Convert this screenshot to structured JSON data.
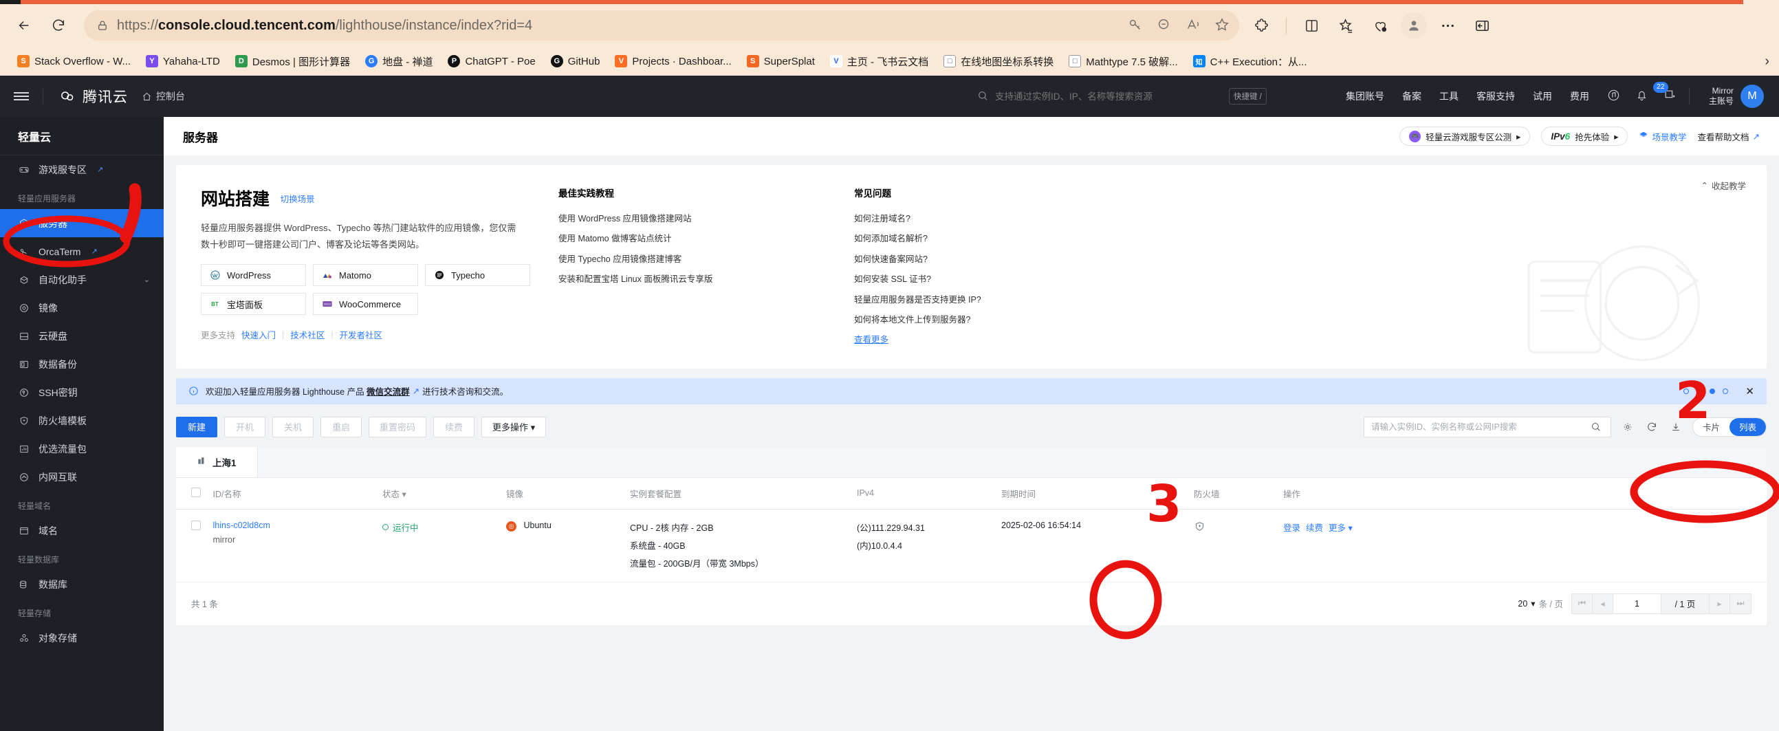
{
  "browser": {
    "url_prefix": "https://",
    "url_domain": "console.cloud.tencent.com",
    "url_path": "/lighthouse/instance/index?rid=4",
    "bookmarks": [
      {
        "label": "Stack Overflow - W...",
        "icon": "stackoverflow-icon",
        "color": "#f48024",
        "glyph": "S"
      },
      {
        "label": "Yahaha-LTD",
        "icon": "yahaha-icon",
        "color": "#7b4cf0",
        "glyph": "Y"
      },
      {
        "label": "Desmos | 图形计算器",
        "icon": "desmos-icon",
        "color": "#2d9a4f",
        "glyph": "D"
      },
      {
        "label": "地盘 - 禅道",
        "icon": "zentao-icon",
        "color": "#2b7cff",
        "glyph": "G"
      },
      {
        "label": "ChatGPT - Poe",
        "icon": "poe-icon",
        "color": "#111111",
        "glyph": "P"
      },
      {
        "label": "GitHub",
        "icon": "github-icon",
        "color": "#111111",
        "glyph": "G"
      },
      {
        "label": "Projects · Dashboar...",
        "icon": "gitlab-icon",
        "color": "#fc6d26",
        "glyph": "V"
      },
      {
        "label": "SuperSplat",
        "icon": "supersplat-icon",
        "color": "#f26722",
        "glyph": "S"
      },
      {
        "label": "主页 - 飞书云文档",
        "icon": "feishu-icon",
        "color": "#2b5fff",
        "glyph": "V"
      },
      {
        "label": "在线地图坐标系转换",
        "icon": "page-icon",
        "color": "#ffffff",
        "glyph": "□"
      },
      {
        "label": "Mathtype 7.5 破解...",
        "icon": "page-icon",
        "color": "#ffffff",
        "glyph": "□"
      },
      {
        "label": "C++ Execution：从...",
        "icon": "zhihu-icon",
        "color": "#0084ff",
        "glyph": "知"
      }
    ],
    "overflow_label": "›"
  },
  "topnav": {
    "brand": "腾讯云",
    "console_label": "控制台",
    "search_placeholder": "支持通过实例ID、IP、名称等搜索资源",
    "shortcut_key": "快捷键 /",
    "menu": [
      "集团账号",
      "备案",
      "工具",
      "客服支持",
      "试用",
      "费用"
    ],
    "notification_count": "22",
    "user_name_line1": "Mirror",
    "user_name_line2": "主账号",
    "user_initial": "M"
  },
  "sidebar": {
    "title": "轻量云",
    "items": [
      {
        "label": "游戏服专区",
        "icon": "gamepad-icon",
        "external": true,
        "active": false
      },
      {
        "group": "轻量应用服务器"
      },
      {
        "label": "服务器",
        "icon": "server-cube-icon",
        "external": false,
        "active": true
      },
      {
        "label": "OrcaTerm",
        "icon": "orcaterm-icon",
        "external": true,
        "active": false
      },
      {
        "label": "自动化助手",
        "icon": "robot-icon",
        "external": false,
        "active": false,
        "expandable": true
      },
      {
        "label": "镜像",
        "icon": "disc-icon",
        "external": false,
        "active": false
      },
      {
        "label": "云硬盘",
        "icon": "harddisk-icon",
        "external": false,
        "active": false
      },
      {
        "label": "数据备份",
        "icon": "backup-icon",
        "external": false,
        "active": false
      },
      {
        "label": "SSH密钥",
        "icon": "key-icon",
        "external": false,
        "active": false
      },
      {
        "label": "防火墙模板",
        "icon": "shield-icon",
        "external": false,
        "active": false
      },
      {
        "label": "优选流量包",
        "icon": "chart-icon",
        "external": false,
        "active": false
      },
      {
        "label": "内网互联",
        "icon": "network-icon",
        "external": false,
        "active": false
      },
      {
        "group": "轻量域名"
      },
      {
        "label": "域名",
        "icon": "window-icon",
        "external": false,
        "active": false
      },
      {
        "group": "轻量数据库"
      },
      {
        "label": "数据库",
        "icon": "database-icon",
        "external": false,
        "active": false
      },
      {
        "group": "轻量存储"
      },
      {
        "label": "对象存储",
        "icon": "cos-icon",
        "external": false,
        "active": false
      }
    ]
  },
  "page": {
    "title": "服务器",
    "header_actions": {
      "game_zone_pill": "轻量云游戏服专区公测",
      "ipv6_pill_prefix": "IPv",
      "ipv6_pill_six": "6",
      "ipv6_pill_label": "抢先体验",
      "scene_tutorial": "场景教学",
      "help_docs": "查看帮助文档"
    }
  },
  "hero": {
    "collapse_label": "收起教学",
    "title": "网站搭建",
    "switch_scene": "切换场景",
    "description": "轻量应用服务器提供 WordPress、Typecho 等热门建站软件的应用镜像，您仅需数十秒即可一键搭建公司门户、博客及论坛等各类网站。",
    "apps": [
      {
        "name": "WordPress",
        "icon": "wordpress-icon",
        "color": "#3858e9"
      },
      {
        "name": "Matomo",
        "icon": "matomo-icon",
        "color": "#3152a0"
      },
      {
        "name": "Typecho",
        "icon": "typecho-icon",
        "color": "#111111"
      },
      {
        "name": "宝塔面板",
        "icon": "baota-icon",
        "color": "#20a53a"
      },
      {
        "name": "WooCommerce",
        "icon": "woocommerce-icon",
        "color": "#7f54b3"
      }
    ],
    "more_support_label": "更多支持",
    "more_links": [
      "快速入门",
      "技术社区",
      "开发者社区"
    ],
    "tutorials_title": "最佳实践教程",
    "tutorials": [
      "使用 WordPress 应用镜像搭建网站",
      "使用 Matomo 做博客站点统计",
      "使用 Typecho 应用镜像搭建博客",
      "安装和配置宝塔 Linux 面板腾讯云专享版"
    ],
    "faq_title": "常见问题",
    "faq": [
      "如何注册域名?",
      "如何添加域名解析?",
      "如何快速备案网站?",
      "如何安装 SSL 证书?",
      "轻量应用服务器是否支持更换 IP?",
      "如何将本地文件上传到服务器?"
    ],
    "faq_more": "查看更多"
  },
  "notice": {
    "text_before": "欢迎加入轻量应用服务器 Lighthouse 产品",
    "link": "微信交流群",
    "text_after": "进行技术咨询和交流。",
    "dots": [
      false,
      false,
      true,
      false
    ],
    "close_label": "✕"
  },
  "toolbar": {
    "buttons": [
      {
        "label": "新建",
        "style": "primary"
      },
      {
        "label": "开机",
        "style": "disabled"
      },
      {
        "label": "关机",
        "style": "disabled"
      },
      {
        "label": "重启",
        "style": "disabled"
      },
      {
        "label": "重置密码",
        "style": "disabled"
      },
      {
        "label": "续费",
        "style": "disabled"
      },
      {
        "label": "更多操作 ▾",
        "style": "enabled"
      }
    ],
    "search_placeholder": "请输入实例ID、实例名称或公网IP搜索",
    "view_card": "卡片",
    "view_list": "列表"
  },
  "table": {
    "region_tab": "上海1",
    "columns": [
      "ID/名称",
      "状态",
      "镜像",
      "实例套餐配置",
      "IPv4",
      "到期时间",
      "防火墙",
      "操作"
    ],
    "rows": [
      {
        "id": "lhins-c02ld8cm",
        "name": "mirror",
        "status": "运行中",
        "image": "Ubuntu",
        "config_line1": "CPU - 2核 内存 - 2GB",
        "config_line2": "系统盘 - 40GB",
        "config_line3": "流量包 - 200GB/月（带宽 3Mbps）",
        "ipv4_public": "(公)111.229.94.31",
        "ipv4_private": "(内)10.0.4.4",
        "expire": "2025-02-06 16:54:14",
        "firewall_icon": "shield-icon",
        "ops": [
          "登录",
          "续费",
          "更多 ▾"
        ]
      }
    ],
    "total_text": "共 1 条",
    "per_page": "20",
    "per_page_suffix": "条 / 页",
    "current_page": "1",
    "total_pages": "/ 1 页"
  },
  "annotations": [
    {
      "label": "1",
      "kind": "stroke-number"
    },
    {
      "label": "2",
      "kind": "stroke-number"
    },
    {
      "label": "3",
      "kind": "stroke-number"
    }
  ],
  "colors": {
    "accent": "#1f6feb",
    "brand_dark": "#21242a",
    "marker_red": "#e8130e",
    "notice_bg": "#d6e4ff",
    "success": "#22a06b"
  }
}
